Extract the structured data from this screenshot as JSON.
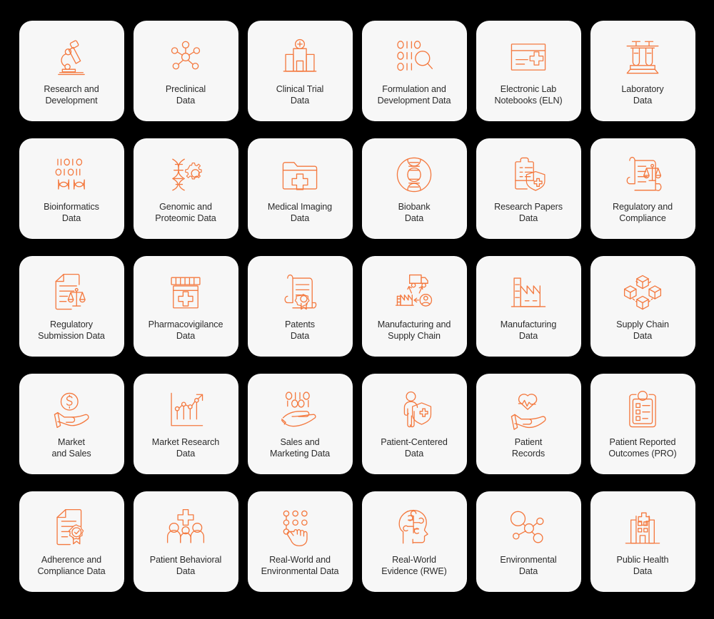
{
  "page": {
    "background_color": "#000000",
    "card_background_color": "#F7F7F7",
    "accent_color": "#F4793F",
    "label_color": "#2C2C2C",
    "columns": 6,
    "rows": 5
  },
  "cards": [
    {
      "label": "Research and\nDevelopment",
      "icon": "microscope-icon"
    },
    {
      "label": "Preclinical\nData",
      "icon": "molecule-network-icon"
    },
    {
      "label": "Clinical Trial\nData",
      "icon": "hospital-building-icon"
    },
    {
      "label": "Formulation and\nDevelopment Data",
      "icon": "binary-search-icon"
    },
    {
      "label": "Electronic Lab\nNotebooks (ELN)",
      "icon": "notebook-plus-icon"
    },
    {
      "label": "Laboratory\nData",
      "icon": "test-tubes-rack-icon"
    },
    {
      "label": "Bioinformatics\nData",
      "icon": "binary-dna-icon"
    },
    {
      "label": "Genomic and\nProteomic Data",
      "icon": "dna-gear-icon"
    },
    {
      "label": "Medical Imaging\nData",
      "icon": "folder-medical-icon"
    },
    {
      "label": "Biobank\nData",
      "icon": "dna-circle-icon"
    },
    {
      "label": "Research Papers\nData",
      "icon": "clipboard-shield-icon"
    },
    {
      "label": "Regulatory and\nCompliance",
      "icon": "scroll-scales-icon"
    },
    {
      "label": "Regulatory\nSubmission Data",
      "icon": "document-scales-icon"
    },
    {
      "label": "Pharmacovigilance\nData",
      "icon": "pill-bottle-icon"
    },
    {
      "label": "Patents\nData",
      "icon": "certificate-scroll-icon"
    },
    {
      "label": "Manufacturing and\nSupply Chain",
      "icon": "truck-factory-user-icon"
    },
    {
      "label": "Manufacturing\nData",
      "icon": "factory-icon"
    },
    {
      "label": "Supply Chain\nData",
      "icon": "boxes-network-icon"
    },
    {
      "label": "Market\nand Sales",
      "icon": "hand-dollar-icon"
    },
    {
      "label": "Market Research\nData",
      "icon": "growth-chart-icon"
    },
    {
      "label": "Sales and\nMarketing Data",
      "icon": "hand-binary-icon"
    },
    {
      "label": "Patient-Centered\nData",
      "icon": "person-shield-icon"
    },
    {
      "label": "Patient\nRecords",
      "icon": "hand-heart-pulse-icon"
    },
    {
      "label": "Patient Reported\nOutcomes (PRO)",
      "icon": "clipboard-checklist-icon"
    },
    {
      "label": "Adherence and\nCompliance Data",
      "icon": "document-seal-icon"
    },
    {
      "label": "Patient Behavioral\nData",
      "icon": "people-medical-cross-icon"
    },
    {
      "label": "Real-World and\nEnvironmental Data",
      "icon": "hand-touch-dots-icon"
    },
    {
      "label": "Real-World\nEvidence (RWE)",
      "icon": "head-circuit-icon"
    },
    {
      "label": "Environmental\nData",
      "icon": "molecule-nodes-icon"
    },
    {
      "label": "Public Health\nData",
      "icon": "hospital-icon"
    }
  ]
}
